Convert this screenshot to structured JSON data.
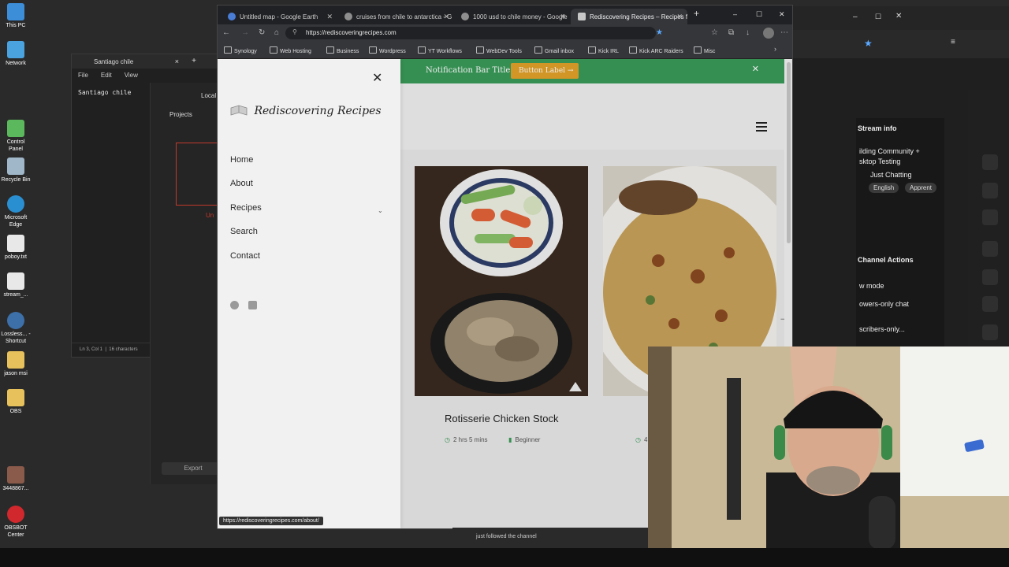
{
  "desktop": {
    "icons": [
      "This PC",
      "Network",
      "Control Panel",
      "Recycle Bin",
      "Microsoft Edge",
      "poboy.txt",
      "stream_...",
      "Lossless... - Shortcut",
      "jason msi",
      "OBS",
      "3448867...",
      "OBSBOT Center"
    ]
  },
  "notepad": {
    "title": "Santiago chile",
    "menu": [
      "File",
      "Edit",
      "View"
    ],
    "content": "Santiago chile",
    "status_position": "Ln 3, Col 1",
    "status_chars": "16 characters"
  },
  "editor": {
    "tab_label": "Local",
    "projects_label": "Projects",
    "export_label": "Export",
    "red_label": "Un"
  },
  "dashboard": {
    "stream_info_title": "Stream info",
    "stream_title_line1": "ilding Community +",
    "stream_title_line2": "sktop Testing",
    "category": "Just Chatting",
    "tags": [
      "English",
      "Apprent"
    ],
    "channel_actions_title": "Channel Actions",
    "actions": [
      "w mode",
      "owers-only chat",
      "scribers-only..."
    ]
  },
  "browser": {
    "tabs": [
      {
        "title": "Untitled map - Google Earth",
        "color": "#4a7dd6"
      },
      {
        "title": "cruises from chile to antarctica - G",
        "color": "#8e8e8e"
      },
      {
        "title": "1000 usd to chile money - Google",
        "color": "#8e8e8e"
      },
      {
        "title": "Rediscovering Recipes – Recipes f",
        "color": "#c7c7c7"
      }
    ],
    "url": "https://rediscoveringrecipes.com",
    "bookmarks": [
      "Synology",
      "Web Hosting",
      "Business",
      "Wordpress",
      "YT Workflows",
      "WebDev Tools",
      "Gmail inbox",
      "Kick IRL",
      "Kick ARC Raiders",
      "Misc"
    ],
    "hover_status": "https://rediscoveringrecipes.com/about/"
  },
  "site": {
    "logo_text": "Rediscovering Recipes",
    "menu": [
      "Home",
      "About",
      "Recipes",
      "Search",
      "Contact"
    ],
    "social_icons": [
      "facebook-icon",
      "youtube-icon"
    ],
    "notification_title": "Notification Bar Title",
    "notification_button": "Button Label →",
    "cards": [
      {
        "title": "Rotisserie Chicken Stock",
        "time": "2 hrs 5 mins",
        "level": "Beginner"
      },
      {
        "title": "",
        "time": "4",
        "level": ""
      }
    ]
  },
  "stream_overlay": {
    "follow_text": "just followed the channel"
  },
  "colors": {
    "accent_green": "#3a9a59",
    "button_orange": "#e2a22b"
  }
}
